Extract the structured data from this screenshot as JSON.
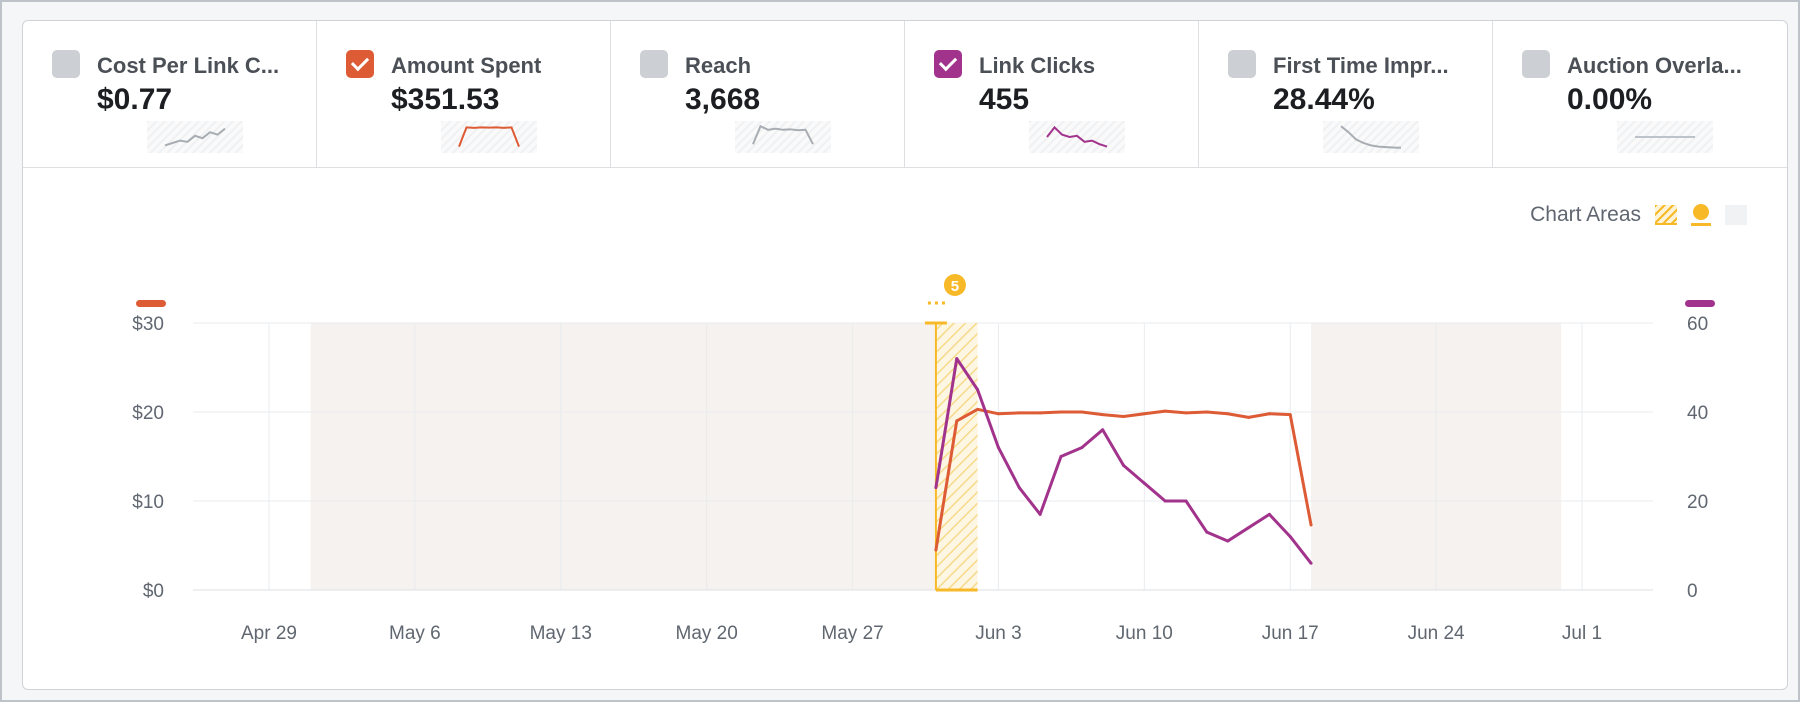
{
  "metrics": [
    {
      "label": "Cost Per Link C...",
      "value": "$0.77",
      "checked": false,
      "color": "#ccd0d5",
      "spark": [
        0.15,
        0.25,
        0.35,
        0.3,
        0.55,
        0.45,
        0.7,
        0.6,
        0.85
      ],
      "spark_color": "#a8adb4"
    },
    {
      "label": "Amount Spent",
      "value": "$351.53",
      "checked": true,
      "color": "#dd5b35",
      "spark": [
        0.1,
        0.9,
        0.88,
        0.9,
        0.89,
        0.9,
        0.88,
        0.9,
        0.1
      ],
      "spark_color": "#dd5b35"
    },
    {
      "label": "Reach",
      "value": "3,668",
      "checked": false,
      "color": "#ccd0d5",
      "spark": [
        0.2,
        0.95,
        0.8,
        0.85,
        0.8,
        0.82,
        0.78,
        0.8,
        0.2
      ],
      "spark_color": "#a8adb4"
    },
    {
      "label": "Link Clicks",
      "value": "455",
      "checked": true,
      "color": "#a2338c",
      "spark": [
        0.5,
        0.9,
        0.6,
        0.5,
        0.55,
        0.3,
        0.35,
        0.2,
        0.1
      ],
      "spark_color": "#a2338c"
    },
    {
      "label": "First Time Impr...",
      "value": "28.44%",
      "checked": false,
      "color": "#ccd0d5",
      "spark": [
        0.95,
        0.7,
        0.4,
        0.25,
        0.15,
        0.1,
        0.08,
        0.06,
        0.05
      ],
      "spark_color": "#a8adb4"
    },
    {
      "label": "Auction Overla...",
      "value": "0.00%",
      "checked": false,
      "color": "#ccd0d5",
      "spark": [
        0.5,
        0.5,
        0.5,
        0.5,
        0.5,
        0.5,
        0.5,
        0.5,
        0.5
      ],
      "spark_color": "#bec3c9"
    }
  ],
  "legend": {
    "label": "Chart Areas"
  },
  "annotation": {
    "badge": "5",
    "date": "2018-05-31",
    "color": "#f7b928"
  },
  "colors": {
    "spent": "#dd5b35",
    "clicks": "#a2338c",
    "shade": "#f6f2ef",
    "grid": "#e9ebee",
    "text": "#606770"
  },
  "chart_data": {
    "type": "line",
    "x_ticks": [
      "Apr 29",
      "May 6",
      "May 13",
      "May 20",
      "May 27",
      "Jun 3",
      "Jun 10",
      "Jun 17",
      "Jun 24",
      "Jul 1"
    ],
    "x_tick_dates": [
      "2018-04-29",
      "2018-05-06",
      "2018-05-13",
      "2018-05-20",
      "2018-05-27",
      "2018-06-03",
      "2018-06-10",
      "2018-06-17",
      "2018-06-24",
      "2018-07-01"
    ],
    "y_left": {
      "ticks": [
        "$0",
        "$10",
        "$20",
        "$30"
      ],
      "range": [
        0,
        30
      ]
    },
    "y_right": {
      "ticks": [
        "0",
        "20",
        "40",
        "60"
      ],
      "range": [
        0,
        60
      ]
    },
    "shaded_ranges": [
      [
        "2018-05-01",
        "2018-05-31"
      ],
      [
        "2018-06-18",
        "2018-06-30"
      ]
    ],
    "highlight_range": [
      "2018-05-31",
      "2018-06-02"
    ],
    "series": [
      {
        "axis": "left",
        "points": [
          [
            "2018-05-31",
            4.5
          ],
          [
            "2018-06-01",
            19
          ],
          [
            "2018-06-02",
            20.3
          ],
          [
            "2018-06-03",
            19.8
          ],
          [
            "2018-06-04",
            19.9
          ],
          [
            "2018-06-05",
            19.9
          ],
          [
            "2018-06-06",
            20
          ],
          [
            "2018-06-07",
            20
          ],
          [
            "2018-06-08",
            19.7
          ],
          [
            "2018-06-09",
            19.5
          ],
          [
            "2018-06-10",
            19.8
          ],
          [
            "2018-06-11",
            20.1
          ],
          [
            "2018-06-12",
            19.9
          ],
          [
            "2018-06-13",
            20
          ],
          [
            "2018-06-14",
            19.8
          ],
          [
            "2018-06-15",
            19.4
          ],
          [
            "2018-06-16",
            19.8
          ],
          [
            "2018-06-17",
            19.7
          ],
          [
            "2018-06-18",
            7.3
          ]
        ]
      },
      {
        "axis": "right",
        "points": [
          [
            "2018-05-31",
            23
          ],
          [
            "2018-06-01",
            52
          ],
          [
            "2018-06-02",
            45
          ],
          [
            "2018-06-03",
            32
          ],
          [
            "2018-06-04",
            23
          ],
          [
            "2018-06-05",
            17
          ],
          [
            "2018-06-06",
            30
          ],
          [
            "2018-06-07",
            32
          ],
          [
            "2018-06-08",
            36
          ],
          [
            "2018-06-09",
            28
          ],
          [
            "2018-06-10",
            24
          ],
          [
            "2018-06-11",
            20
          ],
          [
            "2018-06-12",
            20
          ],
          [
            "2018-06-13",
            13
          ],
          [
            "2018-06-14",
            11
          ],
          [
            "2018-06-15",
            14
          ],
          [
            "2018-06-16",
            17
          ],
          [
            "2018-06-17",
            12
          ],
          [
            "2018-06-18",
            6
          ]
        ]
      }
    ]
  }
}
